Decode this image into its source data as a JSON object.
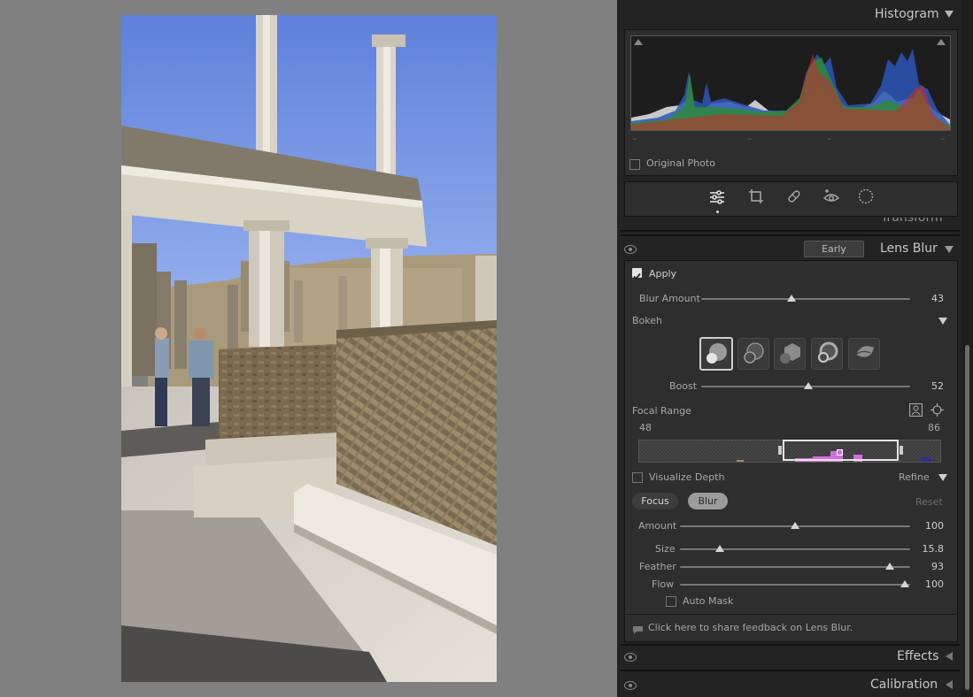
{
  "histogram": {
    "title": "Histogram",
    "original_photo_label": "Original Photo"
  },
  "toolbar": {
    "tools": [
      "edit-icon",
      "crop-icon",
      "heal-icon",
      "redeye-icon",
      "masking-icon"
    ]
  },
  "partial_section_label": "Transform",
  "lens_blur": {
    "early_access_badge": "Early Access",
    "title": "Lens Blur",
    "apply_label": "Apply",
    "apply_checked": true,
    "blur_amount": {
      "label": "Blur Amount",
      "value": "43",
      "fraction": 0.43
    },
    "bokeh": {
      "label": "Bokeh",
      "selected_index": 0,
      "shapes": [
        "circle",
        "bubble",
        "blade",
        "ring",
        "cat-eye"
      ]
    },
    "boost": {
      "label": "Boost",
      "value": "52",
      "fraction": 0.52
    },
    "focal_range": {
      "label": "Focal Range",
      "min": "48",
      "max": "86"
    },
    "visualize_depth_label": "Visualize Depth",
    "refine_label": "Refine",
    "focus_label": "Focus",
    "blur_label": "Blur",
    "reset_label": "Reset",
    "amount": {
      "label": "Amount",
      "value": "100",
      "fraction": 0.5
    },
    "size": {
      "label": "Size",
      "value": "15.8",
      "fraction": 0.17
    },
    "feather": {
      "label": "Feather",
      "value": "93",
      "fraction": 0.93
    },
    "flow": {
      "label": "Flow",
      "value": "100",
      "fraction": 1.0
    },
    "auto_mask_label": "Auto Mask",
    "feedback_text": "Click here to share feedback on Lens Blur."
  },
  "effects": {
    "title": "Effects"
  },
  "calibration": {
    "title": "Calibration"
  },
  "colors": {
    "panel_bg": "#232323",
    "canvas_bg": "#808080",
    "bokeh_active": "#cfcfcf",
    "depth_magenta": "#d26fe0"
  }
}
